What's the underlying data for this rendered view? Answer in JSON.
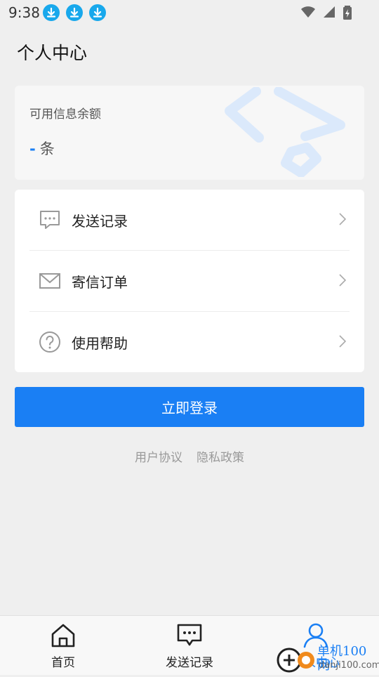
{
  "status_bar": {
    "time": "9:38"
  },
  "page": {
    "title": "个人中心"
  },
  "balance": {
    "label": "可用信息余额",
    "value": "-",
    "unit": "条"
  },
  "menu": {
    "items": [
      {
        "label": "发送记录",
        "icon": "chat-icon"
      },
      {
        "label": "寄信订单",
        "icon": "envelope-icon"
      },
      {
        "label": "使用帮助",
        "icon": "question-icon"
      }
    ]
  },
  "login_button": "立即登录",
  "links": {
    "user_agreement": "用户协议",
    "privacy_policy": "隐私政策"
  },
  "tabbar": {
    "items": [
      {
        "label": "首页",
        "icon": "home-icon"
      },
      {
        "label": "发送记录",
        "icon": "chat-icon"
      },
      {
        "label": "个人中心",
        "icon": "user-icon"
      }
    ],
    "active_index": 2
  },
  "watermark": {
    "text": "单机100网",
    "sub": "danji100.com"
  },
  "colors": {
    "accent": "#1a7ff4",
    "background": "#efefef",
    "card": "#f7f7f7"
  }
}
